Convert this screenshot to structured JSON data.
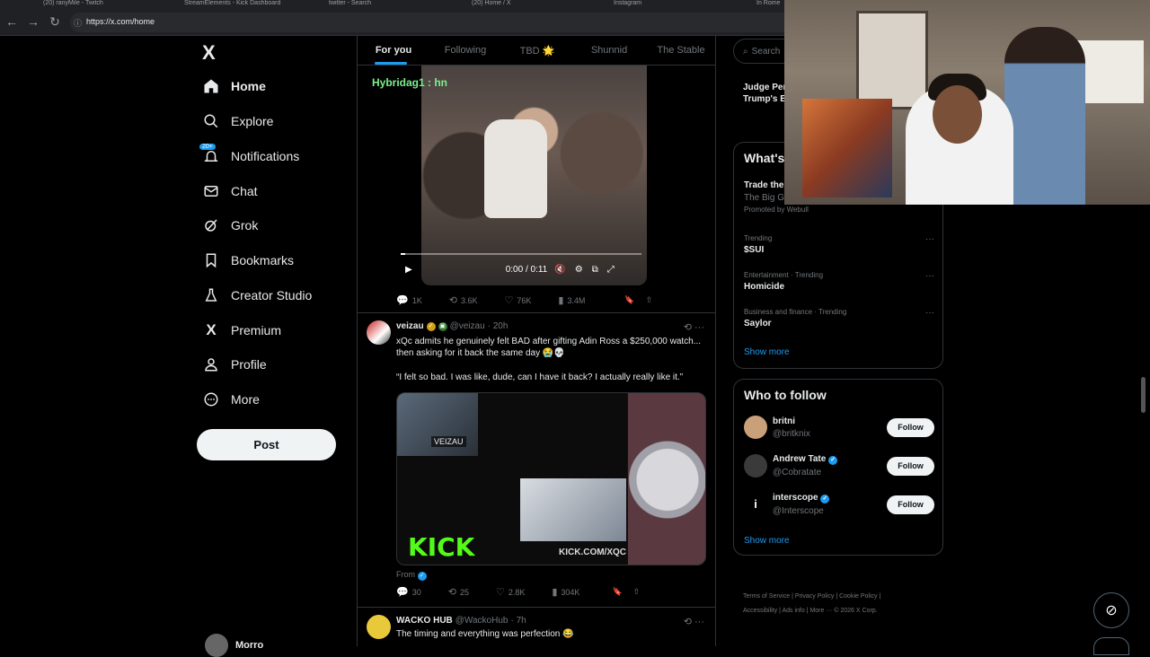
{
  "browser": {
    "tabs": [
      "(20) ranyMile - Twitch",
      "StreamElements - Kick Dashboard",
      "twitter - Search",
      "(20) Home / X",
      "Instagram",
      "In Rome"
    ],
    "url": "https://x.com/home"
  },
  "sidebar": {
    "logo": "X",
    "items": [
      {
        "label": "Home",
        "icon": "home-icon"
      },
      {
        "label": "Explore",
        "icon": "search-icon"
      },
      {
        "label": "Notifications",
        "icon": "bell-icon",
        "badge": "20+"
      },
      {
        "label": "Chat",
        "icon": "mail-icon"
      },
      {
        "label": "Grok",
        "icon": "grok-icon"
      },
      {
        "label": "Bookmarks",
        "icon": "bookmark-icon"
      },
      {
        "label": "Creator Studio",
        "icon": "flask-icon"
      },
      {
        "label": "Premium",
        "icon": "x-icon"
      },
      {
        "label": "Profile",
        "icon": "person-icon"
      },
      {
        "label": "More",
        "icon": "more-circle-icon"
      }
    ],
    "post_label": "Post",
    "me_name": "Morro"
  },
  "feed": {
    "tabs": [
      "For you",
      "Following",
      "TBD 🌟",
      "Shunnid",
      "The Stable"
    ],
    "tweet1": {
      "overlay": "Hybridag1 : hn",
      "time": "0:00 / 0:11",
      "progress": 0.02,
      "stats": {
        "replies": "1K",
        "reposts": "3.6K",
        "likes": "76K",
        "views": "3.4M"
      }
    },
    "tweet2": {
      "name": "veizau",
      "handle": "@veizau",
      "time": "· 20h",
      "text": "xQc admits he genuinely felt BAD after gifting Adin Ross a $250,000 watch... then asking for it back the same day 😭💀",
      "quote": "“I felt so bad. I was like, dude, can I have it back? I actually really like it.”",
      "media_caption": "VEIZAU",
      "media_kick": "KICK",
      "media_url": "KICK.COM/XQC",
      "from_label": "From",
      "stats": {
        "replies": "30",
        "reposts": "25",
        "likes": "2.8K",
        "views": "304K"
      }
    },
    "tweet3": {
      "name": "WACKO HUB",
      "handle": "@WackoHub",
      "time": "· 7h",
      "text": "The timing and everything was perfection 😂"
    }
  },
  "right": {
    "search_placeholder": "Search",
    "news_title": "Judge Per",
    "news_subtitle": "Trump's E",
    "whats_title": "What's",
    "promo": {
      "name": "Trade the",
      "sub": "The Big Ga",
      "promoted": "Promoted by Webull"
    },
    "trends": [
      {
        "category": "Trending",
        "name": "$SUI"
      },
      {
        "category": "Entertainment · Trending",
        "name": "Homicide"
      },
      {
        "category": "Business and finance · Trending",
        "name": "Saylor"
      }
    ],
    "show_more": "Show more",
    "who_title": "Who to follow",
    "follow": [
      {
        "name": "britni",
        "handle": "@britknix"
      },
      {
        "name": "Andrew Tate",
        "handle": "@Cobratate"
      },
      {
        "name": "interscope",
        "handle": "@Interscope"
      }
    ],
    "follow_label": "Follow",
    "footer_line1": "Terms of Service  |  Privacy Policy  |  Cookie Policy  |",
    "footer_line2": "Accessibility  |  Ads info  |  More ···  © 2026 X Corp."
  },
  "colors": {
    "accent": "#1d9bf0",
    "kick": "#53fc18",
    "bg": "#000000"
  }
}
